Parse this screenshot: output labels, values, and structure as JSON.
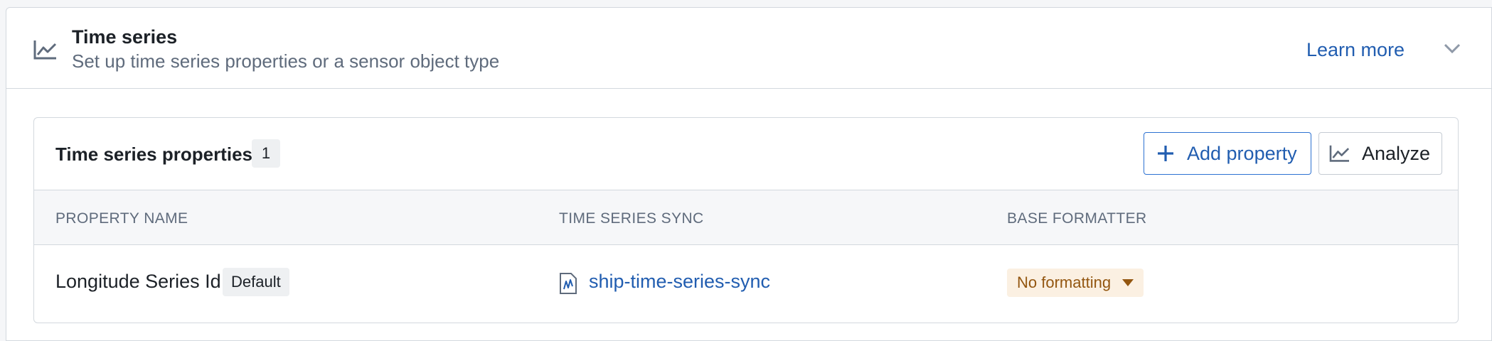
{
  "section": {
    "title": "Time series",
    "subtitle": "Set up time series properties or a sensor object type",
    "learn_more": "Learn more",
    "icon": "line-chart-icon",
    "collapse_icon": "chevron-down-icon"
  },
  "panel": {
    "title": "Time series properties",
    "count": "1",
    "add_property_label": "Add property",
    "analyze_label": "Analyze"
  },
  "table": {
    "columns": [
      "PROPERTY NAME",
      "TIME SERIES SYNC",
      "BASE FORMATTER"
    ],
    "rows": [
      {
        "property_name": "Longitude Series Id",
        "tag": "Default",
        "sync": "ship-time-series-sync",
        "formatter": "No formatting"
      }
    ]
  },
  "colors": {
    "link": "#215db0",
    "muted_text": "#5f6b7c",
    "warning_bg": "#fbf0e2",
    "warning_text": "#935610"
  }
}
